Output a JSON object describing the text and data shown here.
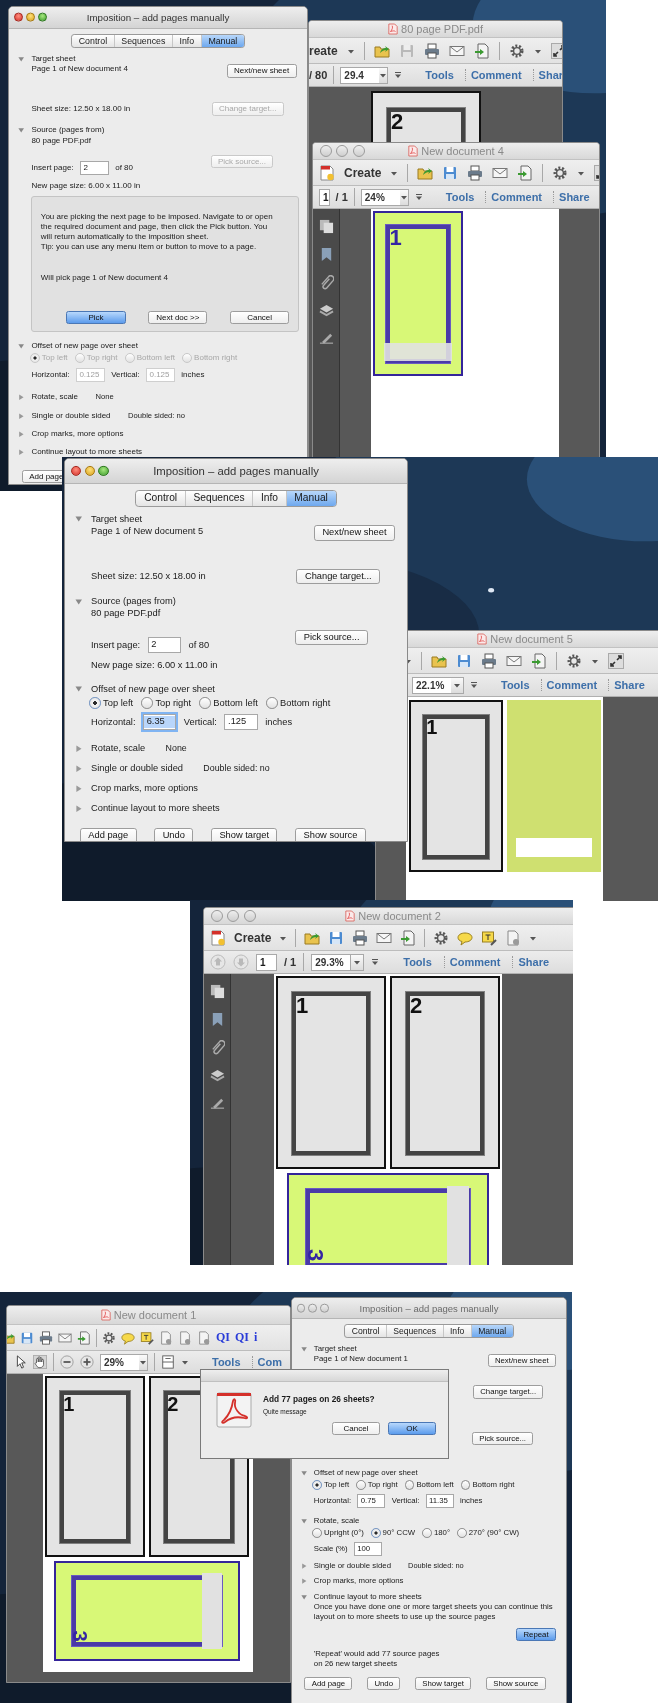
{
  "panels": [
    {
      "windows": [
        {
          "kind": "acrobat",
          "title": "80 page PDF.pdf",
          "controls_visible": false,
          "toolbar": [
            {
              "kind": "label",
              "text": "reate"
            },
            {
              "kind": "caret"
            },
            {
              "kind": "sep"
            },
            {
              "kind": "folder"
            },
            {
              "kind": "save-dim"
            },
            {
              "kind": "print"
            },
            {
              "kind": "mail"
            },
            {
              "kind": "export"
            },
            {
              "kind": "sep"
            },
            {
              "kind": "gear"
            },
            {
              "kind": "caret"
            },
            {
              "kind": "fullscreen"
            }
          ],
          "nav": [
            {
              "kind": "text",
              "text": "/ 80"
            },
            {
              "kind": "sep"
            },
            {
              "kind": "zoom",
              "value": "29.4"
            },
            {
              "kind": "menu"
            },
            {
              "kind": "link",
              "text": "Tools"
            },
            {
              "kind": "link",
              "text": "Comment"
            },
            {
              "kind": "link",
              "text": "Shar"
            }
          ],
          "pages": [
            {
              "kind": "grey",
              "number": "2"
            }
          ]
        },
        {
          "kind": "acrobat",
          "title": "New document 4",
          "controls_visible": true,
          "toolbar": [
            {
              "kind": "create-icon"
            },
            {
              "kind": "label",
              "text": "Create"
            },
            {
              "kind": "caret"
            },
            {
              "kind": "sep"
            },
            {
              "kind": "folder"
            },
            {
              "kind": "save"
            },
            {
              "kind": "print"
            },
            {
              "kind": "mail"
            },
            {
              "kind": "export"
            },
            {
              "kind": "sep"
            },
            {
              "kind": "gear"
            },
            {
              "kind": "caret"
            },
            {
              "kind": "fullscreen"
            }
          ],
          "nav": [
            {
              "kind": "field",
              "value": "1"
            },
            {
              "kind": "text",
              "text": "/ 1"
            },
            {
              "kind": "sep"
            },
            {
              "kind": "zoom",
              "value": "24%"
            },
            {
              "kind": "menu"
            },
            {
              "kind": "link",
              "text": "Tools"
            },
            {
              "kind": "link",
              "text": "Comment"
            },
            {
              "kind": "link",
              "text": "Share"
            }
          ],
          "sidebar": [
            {
              "kind": "pages"
            },
            {
              "kind": "bookmark"
            },
            {
              "kind": "clip"
            },
            {
              "kind": "layers"
            },
            {
              "kind": "sign"
            }
          ],
          "pages": [
            {
              "kind": "green",
              "number": "1"
            }
          ]
        },
        {
          "kind": "dialog",
          "active": true,
          "title": "Imposition – add pages manually",
          "tabs": [
            {
              "label": "Control",
              "selected": false
            },
            {
              "label": "Sequences",
              "selected": false
            },
            {
              "label": "Info",
              "selected": false
            },
            {
              "label": "Manual",
              "selected": true
            }
          ],
          "rows": [
            {
              "kind": "section",
              "label": "Target sheet",
              "expanded": true
            },
            {
              "kind": "line",
              "text": "Page 1 of New document 4",
              "button": {
                "label": "Next/new sheet",
                "disabled": false,
                "default": false
              }
            },
            {
              "kind": "line",
              "text": "Sheet size: 12.50 x 18.00 in",
              "button": {
                "label": "Change target...",
                "disabled": true,
                "default": false
              }
            },
            {
              "kind": "section",
              "label": "Source (pages from)",
              "expanded": true
            },
            {
              "kind": "line",
              "text": "80 page PDF.pdf"
            },
            {
              "kind": "field",
              "label": "Insert page:",
              "value": "2",
              "suffix": "of 80",
              "disabled": false,
              "button": {
                "label": "Pick source...",
                "disabled": true,
                "default": false
              }
            },
            {
              "kind": "line",
              "text": "New page size: 6.00 x 11.00 in"
            },
            {
              "kind": "pick-box",
              "lines": [
                "You are picking the next page to be imposed. Navigate to or open",
                "the required document and page, then click the Pick button. You",
                "will return automatically to the imposition sheet.",
                "Tip: you can use any menu item or button to move to a page."
              ],
              "status": "Will pick page 1 of New document 4",
              "buttons": [
                {
                  "label": "Pick",
                  "disabled": false,
                  "default": true
                },
                {
                  "label": "Next doc >>",
                  "disabled": false,
                  "default": false
                },
                {
                  "label": "Cancel",
                  "disabled": false,
                  "default": false
                }
              ]
            },
            {
              "kind": "section",
              "label": "Offset of new page over sheet",
              "expanded": true
            },
            {
              "kind": "radios",
              "disabled": true,
              "options": [
                {
                  "label": "Top left",
                  "selected": true
                },
                {
                  "label": "Top right",
                  "selected": false
                },
                {
                  "label": "Bottom left",
                  "selected": false
                },
                {
                  "label": "Bottom right",
                  "selected": false
                }
              ]
            },
            {
              "kind": "fields",
              "disabled": true,
              "fields": [
                {
                  "label": "Horizontal:",
                  "value": "0.125",
                  "focused": false
                },
                {
                  "label": "Vertical:",
                  "value": "0.125",
                  "focused": false
                }
              ],
              "suffix": "inches"
            },
            {
              "kind": "section",
              "label": "Rotate, scale",
              "expanded": false,
              "summary": "None"
            },
            {
              "kind": "section",
              "label": "Single or double sided",
              "expanded": false,
              "summary": "Double sided: no"
            },
            {
              "kind": "section",
              "label": "Crop marks, more options",
              "expanded": false
            },
            {
              "kind": "section",
              "label": "Continue layout to more sheets",
              "expanded": false
            }
          ],
          "footer": [
            {
              "label": "Add page",
              "disabled": false,
              "default": false
            }
          ]
        }
      ]
    },
    {
      "windows": [
        {
          "kind": "acrobat",
          "title": "New document 5",
          "controls_visible": false,
          "toolbar": [
            {
              "kind": "caret"
            },
            {
              "kind": "sep"
            },
            {
              "kind": "folder"
            },
            {
              "kind": "save"
            },
            {
              "kind": "print"
            },
            {
              "kind": "mail"
            },
            {
              "kind": "export"
            },
            {
              "kind": "sep"
            },
            {
              "kind": "gear"
            },
            {
              "kind": "caret"
            },
            {
              "kind": "fullscreen"
            }
          ],
          "nav": [
            {
              "kind": "zoom",
              "value": "22.1%"
            },
            {
              "kind": "menu"
            },
            {
              "kind": "link",
              "text": "Tools"
            },
            {
              "kind": "link",
              "text": "Comment"
            },
            {
              "kind": "link",
              "text": "Share"
            }
          ],
          "pages": [
            {
              "kind": "grey",
              "number": "1"
            },
            {
              "kind": "green-plain"
            }
          ]
        },
        {
          "kind": "dialog",
          "active": true,
          "title": "Imposition – add pages manually",
          "tabs": [
            {
              "label": "Control",
              "selected": false
            },
            {
              "label": "Sequences",
              "selected": false
            },
            {
              "label": "Info",
              "selected": false
            },
            {
              "label": "Manual",
              "selected": true
            }
          ],
          "rows": [
            {
              "kind": "section",
              "label": "Target sheet",
              "expanded": true
            },
            {
              "kind": "line",
              "text": "Page 1 of New document 5",
              "button": {
                "label": "Next/new sheet",
                "disabled": false,
                "default": false
              }
            },
            {
              "kind": "line",
              "text": "Sheet size: 12.50 x 18.00 in",
              "button": {
                "label": "Change target...",
                "disabled": false,
                "default": false
              }
            },
            {
              "kind": "section",
              "label": "Source (pages from)",
              "expanded": true
            },
            {
              "kind": "line",
              "text": "80 page PDF.pdf"
            },
            {
              "kind": "field",
              "label": "Insert page:",
              "value": "2",
              "suffix": "of 80",
              "disabled": false,
              "button": {
                "label": "Pick source...",
                "disabled": false,
                "default": false
              }
            },
            {
              "kind": "line",
              "text": "New page size: 6.00 x 11.00 in"
            },
            {
              "kind": "section",
              "label": "Offset of new page over sheet",
              "expanded": true
            },
            {
              "kind": "radios",
              "disabled": false,
              "options": [
                {
                  "label": "Top left",
                  "selected": true
                },
                {
                  "label": "Top right",
                  "selected": false
                },
                {
                  "label": "Bottom left",
                  "selected": false
                },
                {
                  "label": "Bottom right",
                  "selected": false
                }
              ]
            },
            {
              "kind": "fields",
              "disabled": false,
              "fields": [
                {
                  "label": "Horizontal:",
                  "value": "6.35",
                  "focused": true
                },
                {
                  "label": "Vertical:",
                  "value": ".125",
                  "focused": false
                }
              ],
              "suffix": "inches"
            },
            {
              "kind": "section",
              "label": "Rotate, scale",
              "expanded": false,
              "summary": "None"
            },
            {
              "kind": "section",
              "label": "Single or double sided",
              "expanded": false,
              "summary": "Double sided: no"
            },
            {
              "kind": "section",
              "label": "Crop marks, more options",
              "expanded": false
            },
            {
              "kind": "section",
              "label": "Continue layout to more sheets",
              "expanded": false
            }
          ],
          "footer": [
            {
              "label": "Add page",
              "disabled": false,
              "default": false
            },
            {
              "label": "Undo",
              "disabled": false,
              "default": false
            },
            {
              "label": "Show target",
              "disabled": false,
              "default": false
            },
            {
              "label": "Show source",
              "disabled": false,
              "default": false
            }
          ]
        }
      ]
    },
    {
      "windows": [
        {
          "kind": "acrobat",
          "title": "New document 2",
          "controls_visible": true,
          "toolbar": [
            {
              "kind": "create-icon"
            },
            {
              "kind": "label",
              "text": "Create"
            },
            {
              "kind": "caret"
            },
            {
              "kind": "sep"
            },
            {
              "kind": "folder"
            },
            {
              "kind": "save"
            },
            {
              "kind": "print"
            },
            {
              "kind": "mail"
            },
            {
              "kind": "export"
            },
            {
              "kind": "sep"
            },
            {
              "kind": "gear"
            },
            {
              "kind": "bubble"
            },
            {
              "kind": "note"
            },
            {
              "kind": "doc"
            },
            {
              "kind": "caret"
            }
          ],
          "nav": [
            {
              "kind": "up"
            },
            {
              "kind": "down"
            },
            {
              "kind": "field",
              "value": "1"
            },
            {
              "kind": "text",
              "text": "/ 1"
            },
            {
              "kind": "sep"
            },
            {
              "kind": "zoom",
              "value": "29.3%"
            },
            {
              "kind": "menu"
            },
            {
              "kind": "link",
              "text": "Tools"
            },
            {
              "kind": "link",
              "text": "Comment"
            },
            {
              "kind": "link",
              "text": "Share"
            }
          ],
          "sidebar": [
            {
              "kind": "pages"
            },
            {
              "kind": "bookmark"
            },
            {
              "kind": "clip"
            },
            {
              "kind": "layers"
            },
            {
              "kind": "sign"
            }
          ],
          "pages": [
            {
              "kind": "grey",
              "number": "1"
            },
            {
              "kind": "grey",
              "number": "2"
            },
            {
              "kind": "landscape",
              "number": "3"
            }
          ]
        }
      ]
    },
    {
      "windows": [
        {
          "kind": "acrobat",
          "title": "New document 1",
          "controls_visible": false,
          "toolbar": [
            {
              "kind": "folder"
            },
            {
              "kind": "save"
            },
            {
              "kind": "print"
            },
            {
              "kind": "mail"
            },
            {
              "kind": "export"
            },
            {
              "kind": "sep"
            },
            {
              "kind": "gear"
            },
            {
              "kind": "bubble"
            },
            {
              "kind": "note"
            },
            {
              "kind": "doc"
            },
            {
              "kind": "doc"
            },
            {
              "kind": "doc"
            },
            {
              "kind": "qi",
              "text": "QI"
            },
            {
              "kind": "qi",
              "text": "QI"
            },
            {
              "kind": "qi",
              "text": "i"
            }
          ],
          "nav": [
            {
              "kind": "pointer"
            },
            {
              "kind": "hand"
            },
            {
              "kind": "sep"
            },
            {
              "kind": "zoomout"
            },
            {
              "kind": "zoomin"
            },
            {
              "kind": "zoom",
              "value": "29%"
            },
            {
              "kind": "sep"
            },
            {
              "kind": "layout"
            },
            {
              "kind": "caret"
            },
            {
              "kind": "link",
              "text": "Tools"
            },
            {
              "kind": "link",
              "text": "Com"
            }
          ],
          "pages": [
            {
              "kind": "grey",
              "number": "1"
            },
            {
              "kind": "grey",
              "number": "2"
            },
            {
              "kind": "landscape",
              "number": "3"
            }
          ]
        },
        {
          "kind": "dialog",
          "active": false,
          "title": "Imposition – add pages manually",
          "tabs": [
            {
              "label": "Control",
              "selected": false
            },
            {
              "label": "Sequences",
              "selected": false
            },
            {
              "label": "Info",
              "selected": false
            },
            {
              "label": "Manual",
              "selected": true
            }
          ],
          "rows": [
            {
              "kind": "section",
              "label": "Target sheet",
              "expanded": true
            },
            {
              "kind": "line",
              "text": "Page 1 of New document 1",
              "button": {
                "label": "Next/new sheet",
                "disabled": false,
                "default": false
              }
            },
            {
              "kind": "button-only",
              "button": {
                "label": "Change target...",
                "disabled": false,
                "default": false
              }
            },
            {
              "kind": "button-only",
              "button": {
                "label": "Pick source...",
                "disabled": false,
                "default": false
              }
            },
            {
              "kind": "section",
              "label": "Offset of new page over sheet",
              "expanded": true
            },
            {
              "kind": "radios",
              "disabled": false,
              "options": [
                {
                  "label": "Top left",
                  "selected": true
                },
                {
                  "label": "Top right",
                  "selected": false
                },
                {
                  "label": "Bottom left",
                  "selected": false
                },
                {
                  "label": "Bottom right",
                  "selected": false
                }
              ]
            },
            {
              "kind": "fields",
              "disabled": false,
              "fields": [
                {
                  "label": "Horizontal:",
                  "value": "0.75",
                  "focused": false
                },
                {
                  "label": "Vertical:",
                  "value": "11.35",
                  "focused": false
                }
              ],
              "suffix": "inches"
            },
            {
              "kind": "section",
              "label": "Rotate, scale",
              "expanded": true
            },
            {
              "kind": "radios",
              "disabled": false,
              "options": [
                {
                  "label": "Upright (0°)",
                  "selected": false
                },
                {
                  "label": "90° CCW",
                  "selected": true
                },
                {
                  "label": "180°",
                  "selected": false
                },
                {
                  "label": "270° (90° CW)",
                  "selected": false
                }
              ]
            },
            {
              "kind": "field",
              "label": "Scale (%)",
              "value": "100",
              "disabled": false
            },
            {
              "kind": "section",
              "label": "Single or double sided",
              "expanded": false,
              "summary": "Double sided: no"
            },
            {
              "kind": "section",
              "label": "Crop marks, more options",
              "expanded": false
            },
            {
              "kind": "section",
              "label": "Continue layout to more sheets",
              "expanded": true
            },
            {
              "kind": "para",
              "lines": [
                "Once you have done one or more target sheets you can continue this",
                "layout on to more sheets to use up the source pages"
              ]
            },
            {
              "kind": "button-only",
              "button": {
                "label": "Repeat",
                "disabled": false,
                "default": true
              }
            },
            {
              "kind": "para",
              "lines": [
                "'Repeat' would add 77 source pages",
                "on 26 new target sheets"
              ]
            }
          ],
          "footer": [
            {
              "label": "Add page",
              "disabled": false,
              "default": false
            },
            {
              "label": "Undo",
              "disabled": false,
              "default": false
            },
            {
              "label": "Show target",
              "disabled": false,
              "default": false
            },
            {
              "label": "Show source",
              "disabled": false,
              "default": false
            }
          ]
        },
        {
          "kind": "alert",
          "title": "Add 77 pages on 26 sheets?",
          "message": "Quite message",
          "buttons": [
            {
              "label": "Cancel",
              "disabled": false,
              "default": false
            },
            {
              "label": "OK",
              "disabled": false,
              "default": true
            }
          ]
        }
      ]
    }
  ]
}
